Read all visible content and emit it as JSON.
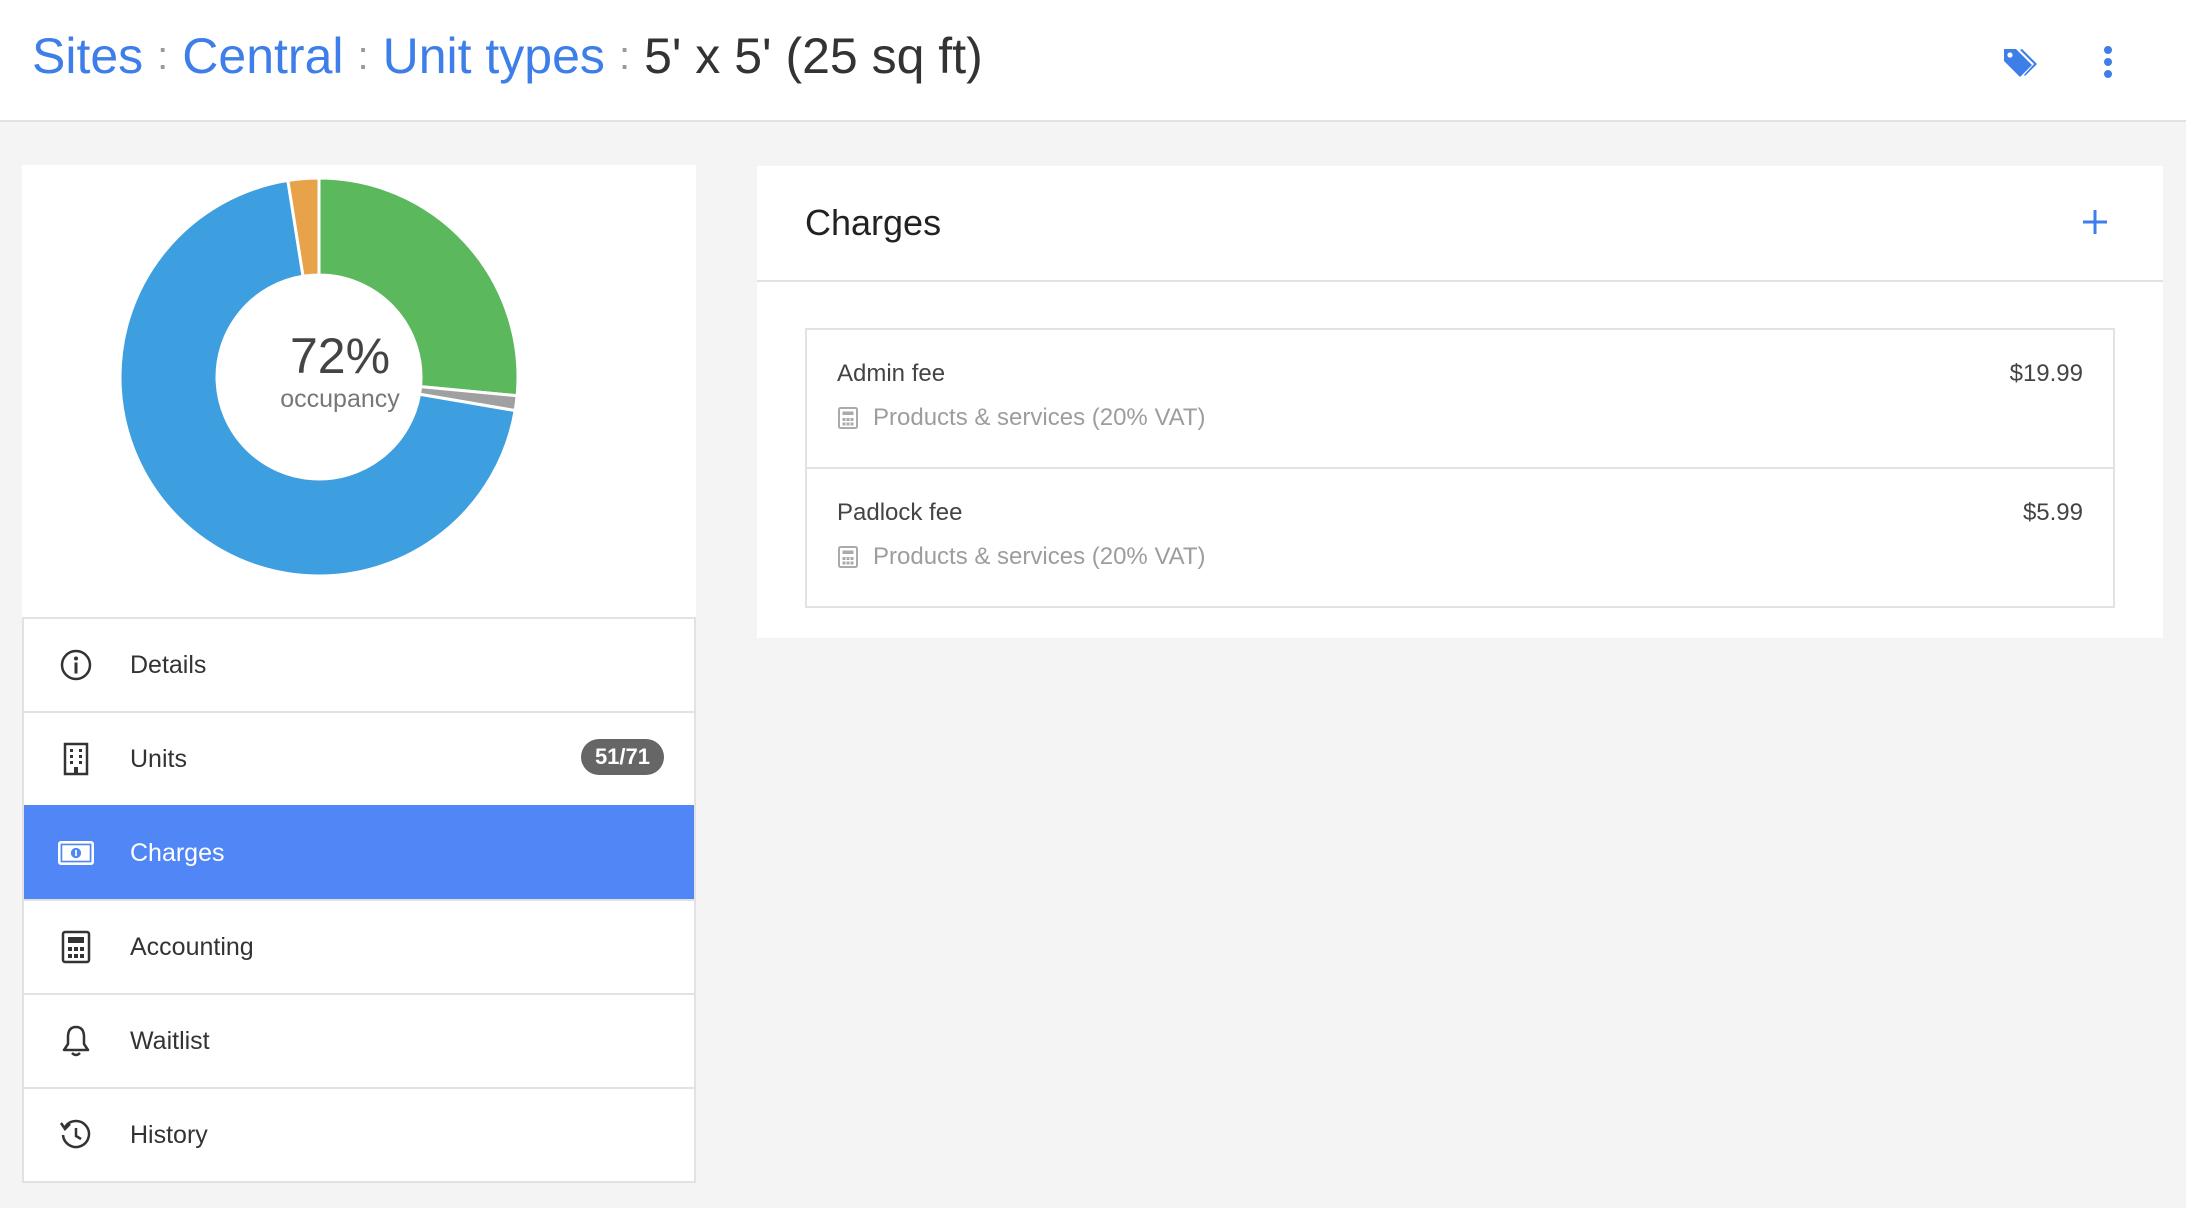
{
  "breadcrumb": {
    "sites": "Sites",
    "site": "Central",
    "unit_types": "Unit types",
    "current": "5' x 5' (25 sq ft)",
    "separator": ":"
  },
  "header_icons": [
    "tag-icon",
    "more-vertical-icon"
  ],
  "occupancy": {
    "percent_label": "72%",
    "label": "occupancy",
    "segments": [
      {
        "value": 0.265,
        "color": "#5cb85c"
      },
      {
        "value": 0.012,
        "color": "#a0a0a0"
      },
      {
        "value": 0.698,
        "color": "#3d9ee0"
      },
      {
        "value": 0.025,
        "color": "#e8a34a"
      }
    ]
  },
  "nav": [
    {
      "label": "Details",
      "icon": "info-icon",
      "active": false
    },
    {
      "label": "Units",
      "icon": "building-icon",
      "active": false,
      "badge": "51/71"
    },
    {
      "label": "Charges",
      "icon": "cash-icon",
      "active": true
    },
    {
      "label": "Accounting",
      "icon": "calculator-icon",
      "active": false
    },
    {
      "label": "Waitlist",
      "icon": "bell-icon",
      "active": false
    },
    {
      "label": "History",
      "icon": "history-icon",
      "active": false
    }
  ],
  "charges": {
    "title": "Charges",
    "items": [
      {
        "name": "Admin fee",
        "amount": "$19.99",
        "category": "Products & services (20% VAT)"
      },
      {
        "name": "Padlock fee",
        "amount": "$5.99",
        "category": "Products & services (20% VAT)"
      }
    ]
  },
  "colors": {
    "accent": "#3d7ee8",
    "active_nav": "#5186f7",
    "badge": "#666666"
  }
}
